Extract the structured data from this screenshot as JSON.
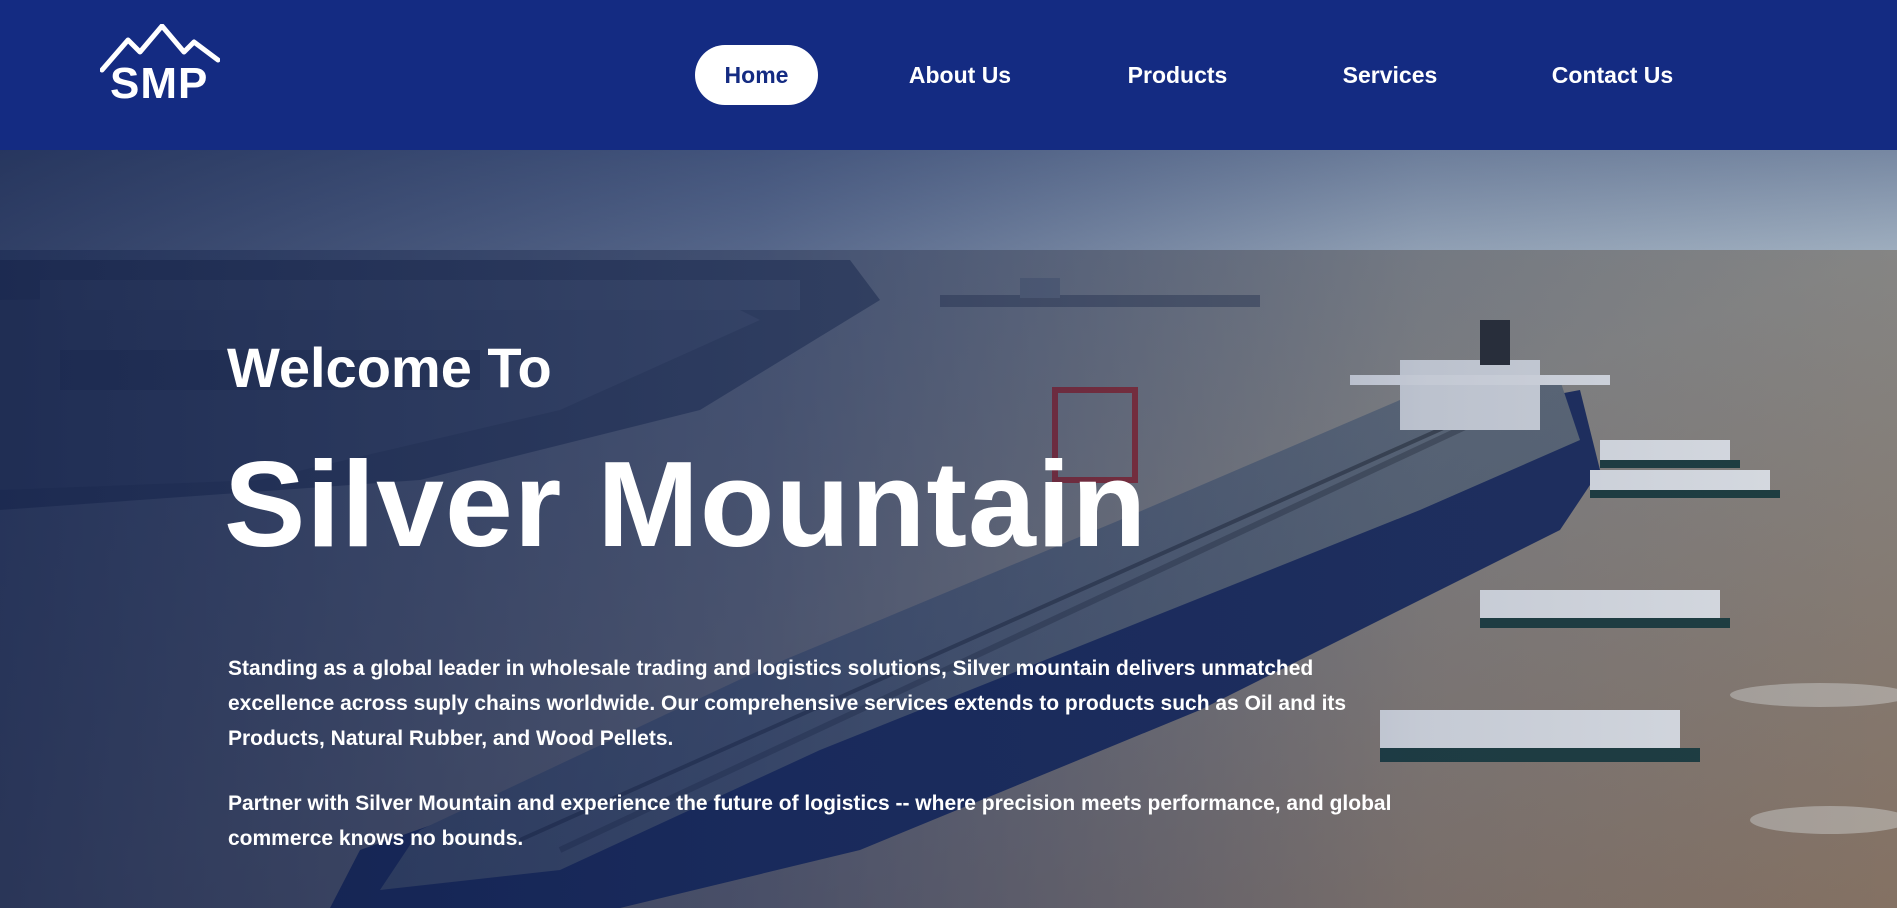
{
  "header": {
    "logo_text": "SMP",
    "nav": [
      {
        "label": "Home",
        "active": true
      },
      {
        "label": "About Us",
        "active": false
      },
      {
        "label": "Products",
        "active": false
      },
      {
        "label": "Services",
        "active": false
      },
      {
        "label": "Contact Us",
        "active": false
      }
    ]
  },
  "hero": {
    "welcome": "Welcome To",
    "title": "Silver Mountain",
    "paragraph_1": "Standing as a global leader in wholesale trading and logistics solutions, Silver mountain delivers unmatched excellence across suply chains worldwide. Our comprehensive services extends to products such as Oil and its Products, Natural Rubber, and Wood Pellets.",
    "paragraph_2": "Partner with Silver Mountain and experience the future of logistics -- where precision meets performance, and global commerce knows no bounds.",
    "background_image": "oil-tanker-port-aerial"
  },
  "colors": {
    "header_bg": "#142b82",
    "active_pill_bg": "#ffffff",
    "active_pill_text": "#142b82",
    "text": "#ffffff"
  }
}
